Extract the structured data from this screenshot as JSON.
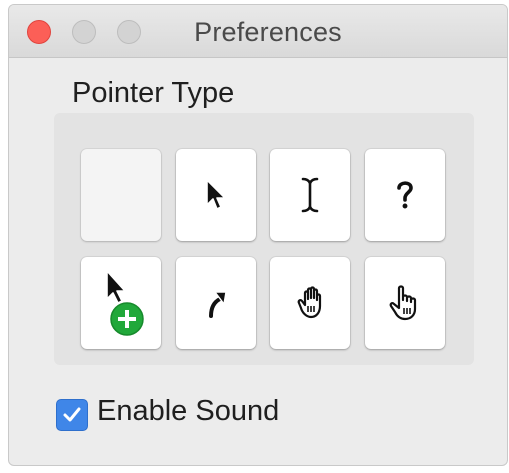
{
  "window": {
    "title": "Preferences",
    "controls": [
      "close",
      "minimize",
      "zoom"
    ],
    "close_color": "#fc5f57",
    "inactive_control_color": "#d3d3d3"
  },
  "pointer_section": {
    "title": "Pointer Type",
    "tiles": [
      {
        "icon": "blank",
        "state": "empty"
      },
      {
        "icon": "arrow-pointer-icon"
      },
      {
        "icon": "ibeam-cursor-icon"
      },
      {
        "icon": "question-cursor-icon"
      },
      {
        "icon": "copy-add-cursor-icon",
        "badge_color": "#21a83a"
      },
      {
        "icon": "alias-curved-arrow-icon"
      },
      {
        "icon": "open-hand-cursor-icon"
      },
      {
        "icon": "pointing-hand-cursor-icon"
      }
    ]
  },
  "options": {
    "enable_sound_label": "Enable Sound",
    "enable_sound_checked": true,
    "accent_color": "#3f86e8"
  }
}
